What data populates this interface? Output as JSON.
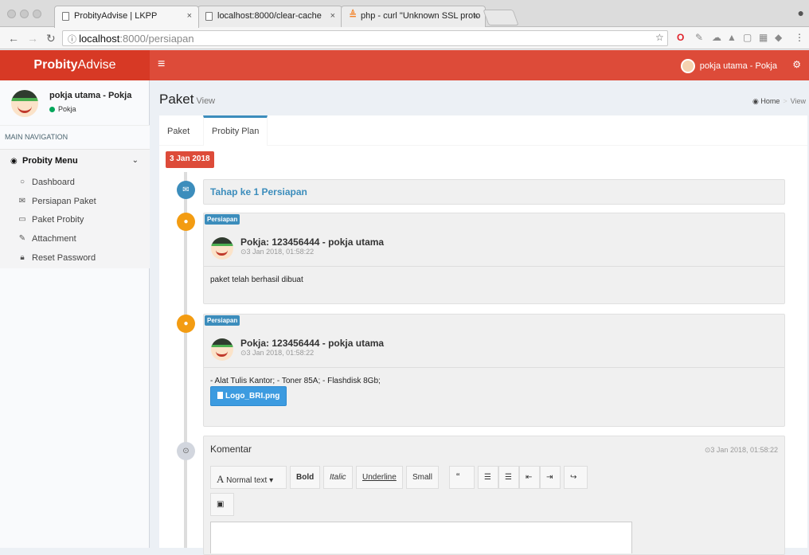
{
  "browser": {
    "tabs": [
      {
        "title": "ProbityAdvise | LKPP"
      },
      {
        "title": "localhost:8000/clear-cache"
      },
      {
        "title": "php - curl \"Unknown SSL proto"
      }
    ],
    "url_host": "localhost",
    "url_path": ":8000/persiapan",
    "close_glyph": "×"
  },
  "header": {
    "logo_bold": "Probity",
    "logo_rest": "Advise",
    "user_label": "pokja utama - Pokja"
  },
  "sidebar": {
    "user_name": "pokja utama - Pokja",
    "user_status": "Pokja",
    "nav_header": "MAIN NAVIGATION",
    "menu_label": "Probity Menu",
    "items": [
      {
        "label": "Dashboard",
        "icon": "circle-icon"
      },
      {
        "label": "Persiapan Paket",
        "icon": "envelope-icon"
      },
      {
        "label": "Paket Probity",
        "icon": "inbox-icon"
      },
      {
        "label": "Attachment",
        "icon": "edit-icon"
      },
      {
        "label": "Reset Password",
        "icon": "lock-icon"
      }
    ]
  },
  "content": {
    "title": "Paket",
    "subtitle": "View",
    "breadcrumb": {
      "home": "Home",
      "current": "View"
    },
    "tabs": [
      {
        "label": "Paket"
      },
      {
        "label": "Probity Plan"
      }
    ]
  },
  "timeline": {
    "date": "3 Jan 2018",
    "step": "Tahap ke 1 Persiapan",
    "posts": [
      {
        "badge": "Persiapan",
        "author": "Pokja: 123456444 - pokja utama",
        "time": "3 Jan 2018, 01:58:22",
        "body": "paket telah berhasil dibuat"
      },
      {
        "badge": "Persiapan",
        "author": "Pokja: 123456444 - pokja utama",
        "time": "3 Jan 2018, 01:58:22",
        "body": "- Alat Tulis Kantor; - Toner 85A; - Flashdisk 8Gb;",
        "file": "Logo_BRI.png"
      }
    ],
    "comment": {
      "title": "Komentar",
      "time": "3 Jan 2018, 01:58:22",
      "toolbar": {
        "normal_text": "Normal text",
        "bold": "Bold",
        "italic": "Italic",
        "underline": "Underline",
        "small": "Small"
      }
    }
  }
}
